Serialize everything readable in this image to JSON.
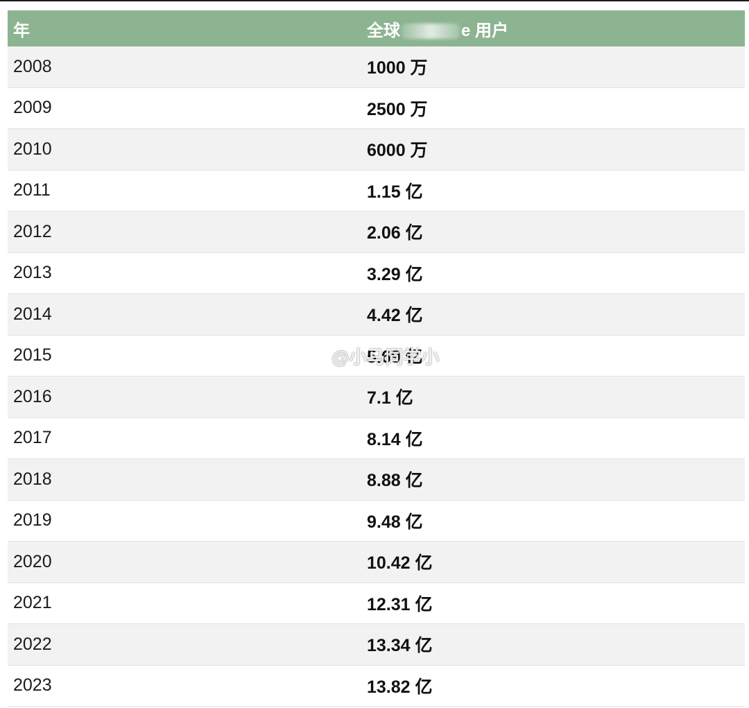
{
  "table": {
    "header": {
      "year": "年",
      "users_prefix": "全球",
      "users_suffix": "e 用户"
    },
    "rows": [
      {
        "year": "2008",
        "users": "1000 万"
      },
      {
        "year": "2009",
        "users": "2500 万"
      },
      {
        "year": "2010",
        "users": "6000 万"
      },
      {
        "year": "2011",
        "users": "1.15 亿"
      },
      {
        "year": "2012",
        "users": "2.06 亿"
      },
      {
        "year": "2013",
        "users": "3.29 亿"
      },
      {
        "year": "2014",
        "users": "4.42 亿"
      },
      {
        "year": "2015",
        "users": "5.69 亿"
      },
      {
        "year": "2016",
        "users": "7.1 亿"
      },
      {
        "year": "2017",
        "users": "8.14 亿"
      },
      {
        "year": "2018",
        "users": "8.88 亿"
      },
      {
        "year": "2019",
        "users": "9.48 亿"
      },
      {
        "year": "2020",
        "users": "10.42 亿"
      },
      {
        "year": "2021",
        "users": "12.31 亿"
      },
      {
        "year": "2022",
        "users": "13.34 亿"
      },
      {
        "year": "2023",
        "users": "13.82 亿"
      }
    ]
  },
  "watermark": {
    "icon": "weibo-icon",
    "text": "@小马同学小"
  },
  "colors": {
    "header_bg": "#8cb491",
    "stripe_bg": "#f2f2f2"
  }
}
